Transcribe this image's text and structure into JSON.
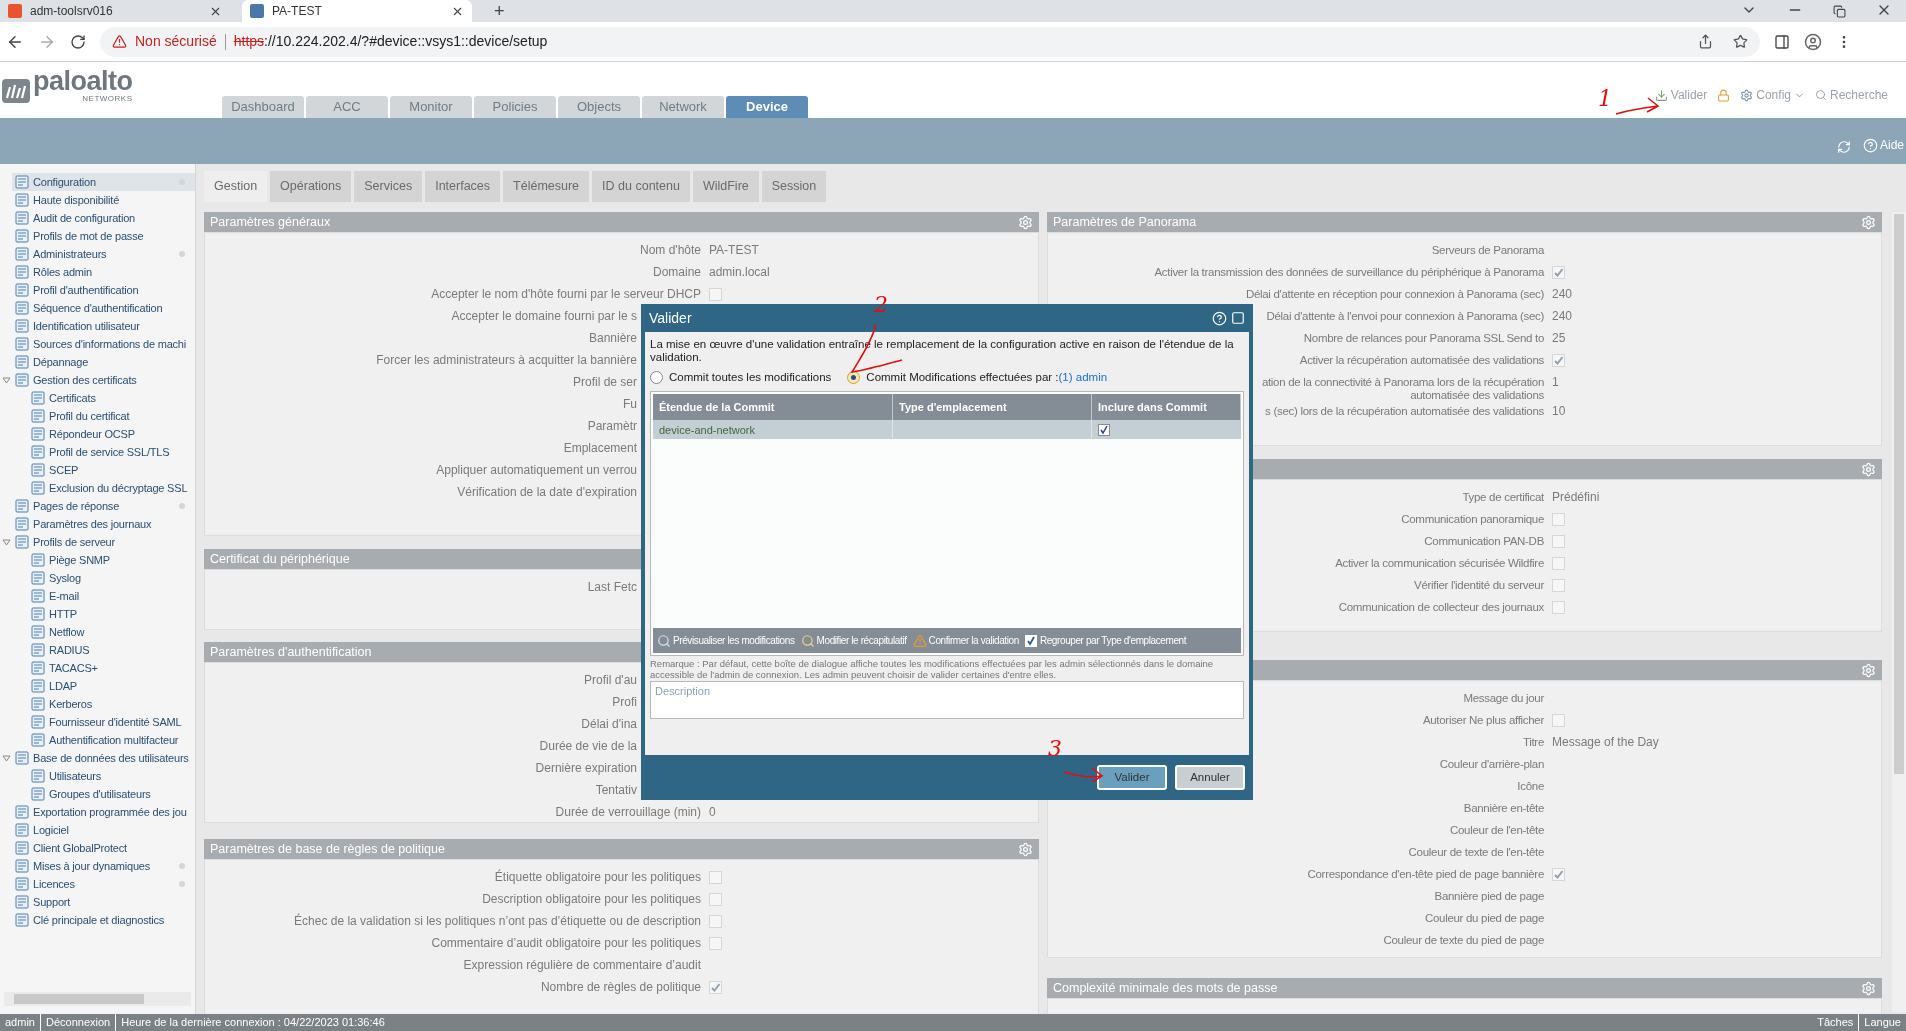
{
  "browser": {
    "tabs": [
      {
        "title": "adm-toolsrv016",
        "selected": false
      },
      {
        "title": "PA-TEST",
        "selected": true
      }
    ],
    "new_tab": "+",
    "security": "Non sécurisé",
    "url_scheme": "https",
    "url_rest": "://10.224.202.4/?#device::vsys1::device/setup"
  },
  "logo": {
    "name": "paloalto",
    "tagline": "NETWORKS"
  },
  "nav_tabs": [
    {
      "label": "Dashboard",
      "selected": false
    },
    {
      "label": "ACC",
      "selected": false
    },
    {
      "label": "Monitor",
      "selected": false
    },
    {
      "label": "Policies",
      "selected": false
    },
    {
      "label": "Objects",
      "selected": false
    },
    {
      "label": "Network",
      "selected": false
    },
    {
      "label": "Device",
      "selected": true
    }
  ],
  "header_actions": {
    "commit": "Valider",
    "config": "Config",
    "search": "Recherche"
  },
  "help": "Aide",
  "sidebar": [
    {
      "label": "Configuration",
      "selected": true,
      "dot": true
    },
    {
      "label": "Haute disponibilité",
      "selected": false,
      "dot": false
    },
    {
      "label": "Audit de configuration",
      "selected": false,
      "dot": false
    },
    {
      "label": "Profils de mot de passe",
      "selected": false,
      "dot": false
    },
    {
      "label": "Administrateurs",
      "selected": false,
      "dot": true
    },
    {
      "label": "Rôles admin",
      "selected": false,
      "dot": false
    },
    {
      "label": "Profil d'authentification",
      "selected": false,
      "dot": false
    },
    {
      "label": "Séquence d'authentification",
      "selected": false,
      "dot": false
    },
    {
      "label": "Identification utilisateur",
      "selected": false,
      "dot": false
    },
    {
      "label": "Sources d'informations de machi",
      "selected": false,
      "dot": false
    },
    {
      "label": "Dépannage",
      "selected": false,
      "dot": false
    },
    {
      "label": "Gestion des certificats",
      "selected": false,
      "dot": false,
      "expanded": true,
      "children": [
        {
          "label": "Certificats",
          "selected": false
        },
        {
          "label": "Profil du certificat",
          "selected": false
        },
        {
          "label": "Répondeur OCSP",
          "selected": false
        },
        {
          "label": "Profil de service SSL/TLS",
          "selected": false
        },
        {
          "label": "SCEP",
          "selected": false
        },
        {
          "label": "Exclusion du décryptage SSL",
          "selected": false
        }
      ]
    },
    {
      "label": "Pages de réponse",
      "selected": false,
      "dot": true
    },
    {
      "label": "Paramètres des journaux",
      "selected": false,
      "dot": false
    },
    {
      "label": "Profils de serveur",
      "selected": false,
      "dot": false,
      "expanded": true,
      "children": [
        {
          "label": "Piège SNMP",
          "selected": false
        },
        {
          "label": "Syslog",
          "selected": false
        },
        {
          "label": "E-mail",
          "selected": false
        },
        {
          "label": "HTTP",
          "selected": false
        },
        {
          "label": "Netflow",
          "selected": false
        },
        {
          "label": "RADIUS",
          "selected": false
        },
        {
          "label": "TACACS+",
          "selected": false
        },
        {
          "label": "LDAP",
          "selected": false
        },
        {
          "label": "Kerberos",
          "selected": false
        },
        {
          "label": "Fournisseur d'identité SAML",
          "selected": false
        },
        {
          "label": "Authentification multifacteur",
          "selected": false
        }
      ]
    },
    {
      "label": "Base de données des utilisateurs",
      "selected": false,
      "dot": false,
      "expanded": true,
      "children": [
        {
          "label": "Utilisateurs",
          "selected": false
        },
        {
          "label": "Groupes d'utilisateurs",
          "selected": false
        }
      ]
    },
    {
      "label": "Exportation programmée des jou",
      "selected": false,
      "dot": false
    },
    {
      "label": "Logiciel",
      "selected": false,
      "dot": false
    },
    {
      "label": "Client GlobalProtect",
      "selected": false,
      "dot": false
    },
    {
      "label": "Mises à jour dynamiques",
      "selected": false,
      "dot": true
    },
    {
      "label": "Licences",
      "selected": false,
      "dot": true
    },
    {
      "label": "Support",
      "selected": false,
      "dot": false
    },
    {
      "label": "Clé principale et diagnostics",
      "selected": false,
      "dot": false
    }
  ],
  "sub_tabs": [
    {
      "label": "Gestion",
      "selected": true
    },
    {
      "label": "Opérations",
      "selected": false
    },
    {
      "label": "Services",
      "selected": false
    },
    {
      "label": "Interfaces",
      "selected": false
    },
    {
      "label": "Télémesure",
      "selected": false
    },
    {
      "label": "ID du contenu",
      "selected": false
    },
    {
      "label": "WildFire",
      "selected": false
    },
    {
      "label": "Session",
      "selected": false
    }
  ],
  "left_sections": [
    {
      "title": "Paramètres généraux",
      "settings_button": true,
      "rows": [
        {
          "kind": "text",
          "label": "Nom d'hôte",
          "value": "PA-TEST"
        },
        {
          "kind": "text",
          "label": "Domaine",
          "value": "admin.local"
        },
        {
          "kind": "checkbox",
          "label": "Accepter le nom d'hôte fourni par le serveur DHCP",
          "checked": false
        },
        {
          "kind": "cut",
          "label": "Accepter le domaine fourni par le s"
        },
        {
          "kind": "cut",
          "label": "Bannière"
        },
        {
          "kind": "cut",
          "label": "Forcer les administrateurs à acquitter la bannière"
        },
        {
          "kind": "cut",
          "label": "Profil de ser"
        },
        {
          "kind": "cut",
          "label": "Fu"
        },
        {
          "kind": "cut",
          "label": "Paramètr"
        },
        {
          "kind": "cut",
          "label": "Emplacement"
        },
        {
          "kind": "cut",
          "label": "Appliquer automatiquement un verrou"
        },
        {
          "kind": "cut",
          "label": "Vérification de la date d'expiration"
        }
      ]
    },
    {
      "title": "Certificat du périphérique",
      "settings_button": false,
      "rows": [
        {
          "kind": "cut",
          "label": "Last Fetc"
        }
      ]
    },
    {
      "title": "Paramètres d'authentification",
      "settings_button": false,
      "rows": [
        {
          "kind": "cut",
          "label": "Profil d'au"
        },
        {
          "kind": "cut",
          "label": "Profi"
        },
        {
          "kind": "cut",
          "label": "Délai d'ina"
        },
        {
          "kind": "cut",
          "label": "Durée de vie de la"
        },
        {
          "kind": "cut",
          "label": "Dernière expiration"
        },
        {
          "kind": "cut",
          "label": "Tentativ"
        },
        {
          "kind": "text",
          "label": "Durée de verrouillage (min)",
          "value": "0"
        }
      ]
    },
    {
      "title": "Paramètres de base de règles de politique",
      "settings_button": true,
      "rows": [
        {
          "kind": "checkbox",
          "label": "Étiquette obligatoire pour les politiques",
          "checked": false
        },
        {
          "kind": "checkbox",
          "label": "Description obligatoire pour les politiques",
          "checked": false
        },
        {
          "kind": "checkbox",
          "label": "Échec de la validation si les politiques n’ont pas d’étiquette ou de description",
          "checked": false
        },
        {
          "kind": "checkbox",
          "label": "Commentaire d’audit obligatoire pour les politiques",
          "checked": false
        },
        {
          "kind": "text",
          "label": "Expression régulière de commentaire d’audit"
        },
        {
          "kind": "checkbox",
          "label": "Nombre de règles de politique",
          "checked": true
        }
      ]
    }
  ],
  "right_sections": [
    {
      "title": "Paramètres de Panorama",
      "settings_button": true,
      "rows": [
        {
          "kind": "text",
          "label": "Serveurs de Panorama"
        },
        {
          "kind": "checkbox",
          "label": "Activer la transmission des données de surveillance du périphérique à Panorama",
          "checked": true
        },
        {
          "kind": "text",
          "label": "Délai d'attente en réception pour connexion à Panorama (sec)",
          "value": "240"
        },
        {
          "kind": "text",
          "label": "Délai d'attente à l'envoi pour connexion à Panorama (sec)",
          "value": "240"
        },
        {
          "kind": "text",
          "label": "Nombre de relances pour Panorama SSL Send to",
          "value": "25"
        },
        {
          "kind": "checkbox",
          "label": "Activer la récupération automatisée des validations",
          "checked": true
        },
        {
          "kind": "text",
          "label": "ation de la connectivité à Panorama lors de la récupération\nautomatisée des validations",
          "value": "1"
        },
        {
          "kind": "text",
          "label": "s (sec) lors de la récupération automatisée des validations",
          "value": "10"
        }
      ]
    },
    {
      "settings_button": true,
      "rows": [
        {
          "kind": "text",
          "label": "Type de certificat",
          "value": "Prédéfini"
        },
        {
          "kind": "checkbox",
          "label": "Communication panoramique",
          "checked": false
        },
        {
          "kind": "checkbox",
          "label": "Communication PAN-DB",
          "checked": false
        },
        {
          "kind": "checkbox",
          "label": "Activer la communication sécurisée Wildfire",
          "checked": false
        },
        {
          "kind": "checkbox",
          "label": "Vérifier l'identité du serveur",
          "checked": false
        },
        {
          "kind": "checkbox",
          "label": "Communication de collecteur des journaux",
          "checked": false
        }
      ]
    },
    {
      "settings_button": true,
      "rows": [
        {
          "kind": "text",
          "label": "Message du jour"
        },
        {
          "kind": "checkbox",
          "label": "Autoriser Ne plus afficher",
          "checked": false
        },
        {
          "kind": "text",
          "label": "Titre",
          "value": "Message of the Day"
        },
        {
          "kind": "text",
          "label": "Couleur d'arrière-plan"
        },
        {
          "kind": "text",
          "label": "Icône"
        },
        {
          "kind": "text",
          "label": "Bannière en-tête"
        },
        {
          "kind": "text",
          "label": "Couleur de l'en-tête"
        },
        {
          "kind": "text",
          "label": "Couleur de texte de l'en-tête"
        },
        {
          "kind": "checkbox",
          "label": "Correspondance d'en-tête pied de page bannière",
          "checked": true
        },
        {
          "kind": "text",
          "label": "Bannière pied de page"
        },
        {
          "kind": "text",
          "label": "Couleur du pied de page"
        },
        {
          "kind": "text",
          "label": "Couleur de texte du pied de page"
        }
      ]
    },
    {
      "title": "Complexité minimale des mots de passe",
      "settings_button": true
    }
  ],
  "dialog": {
    "title": "Valider",
    "message": "La mise en œuvre d'une validation entraîne le remplacement de la configuration active en raison de l'étendue de la validation.",
    "scope_options": [
      {
        "label": "Commit toutes les modifications",
        "selected": false
      },
      {
        "label": "Commit Modifications effectuées par :",
        "link": "(1) admin",
        "selected": true
      }
    ],
    "table": {
      "columns": [
        "Étendue de la Commit",
        "Type d'emplacement",
        "Inclure dans Commit"
      ],
      "rows": [
        {
          "scope": "device-and-network",
          "selected": true,
          "include": true
        }
      ]
    },
    "toolbar": [
      {
        "kind": "preview",
        "label": "Prévisualiser les modifications"
      },
      {
        "kind": "summary",
        "label": "Modifier le récapitulatif"
      },
      {
        "kind": "validate",
        "label": "Confirmer la validation"
      }
    ],
    "group_by": {
      "label": "Regrouper par Type d'emplacement",
      "checked": true
    },
    "note": "Remarque : Par défaut, cette boîte de dialogue affiche toutes les modifications effectuées par les admin sélectionnés dans le domaine accessible de l'admin de connexion. Les admin peuvent choisir de valider certaines d'entre elles.",
    "description": {
      "placeholder": "Description"
    },
    "buttons": [
      {
        "label": "Valider",
        "primary": true
      },
      {
        "label": "Annuler",
        "primary": false
      }
    ]
  },
  "annotations": [
    {
      "text": "1"
    },
    {
      "text": "2"
    },
    {
      "text": "3"
    }
  ],
  "status_bar": {
    "left": [
      "admin",
      "Déconnexion",
      "Heure de la dernière connexion : 04/22/2023 01:36:46"
    ],
    "right": [
      "Tâches",
      "Langue"
    ]
  }
}
